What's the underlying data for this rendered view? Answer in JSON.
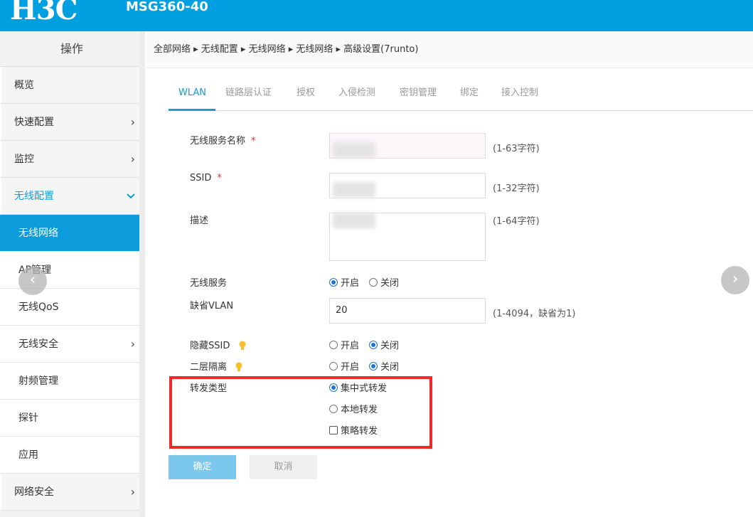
{
  "header": {
    "logo": "H3C",
    "model": "MSG360-40"
  },
  "sidebar": {
    "title": "操作",
    "items": [
      {
        "label": "概览",
        "chevron": ""
      },
      {
        "label": "快速配置",
        "chevron": "›"
      },
      {
        "label": "监控",
        "chevron": "›"
      },
      {
        "label": "无线配置",
        "chevron": "⌄"
      }
    ],
    "sub_items": [
      {
        "label": "无线网络",
        "chevron": ""
      },
      {
        "label": "AP管理",
        "chevron": ""
      },
      {
        "label": "无线QoS",
        "chevron": ""
      },
      {
        "label": "无线安全",
        "chevron": "›"
      },
      {
        "label": "射频管理",
        "chevron": ""
      },
      {
        "label": "探针",
        "chevron": ""
      },
      {
        "label": "应用",
        "chevron": ""
      }
    ],
    "bottom_item": {
      "label": "网络安全",
      "chevron": "›"
    }
  },
  "breadcrumb": "全部网络 ▸ 无线配置 ▸ 无线网络 ▸ 无线网络 ▸ 高级设置(7runto)",
  "tabs": [
    "WLAN",
    "链路层认证",
    "授权",
    "入侵检测",
    "密钥管理",
    "绑定",
    "接入控制"
  ],
  "form": {
    "service_name": {
      "label": "无线服务名称",
      "required": "*",
      "hint": "(1-63字符)"
    },
    "ssid": {
      "label": "SSID",
      "required": "*",
      "hint": "(1-32字符)"
    },
    "description": {
      "label": "描述",
      "hint": "(1-64字符)"
    },
    "wireless_service": {
      "label": "无线服务",
      "on": "开启",
      "off": "关闭",
      "selected": "开启"
    },
    "default_vlan": {
      "label": "缺省VLAN",
      "value": "20",
      "hint": "(1-4094，缺省为1)"
    },
    "hide_ssid": {
      "label": "隐藏SSID",
      "on": "开启",
      "off": "关闭",
      "selected": "关闭"
    },
    "l2_isolation": {
      "label": "二层隔离",
      "on": "开启",
      "off": "关闭",
      "selected": "关闭"
    },
    "forwarding_type": {
      "label": "转发类型",
      "centralized": "集中式转发",
      "local": "本地转发",
      "policy": "策略转发",
      "selected": "集中式转发"
    }
  },
  "buttons": {
    "ok": "确定",
    "cancel": "取消"
  },
  "nav": {
    "prev": "‹",
    "next": "›"
  },
  "colors": {
    "header": "#00a0e0",
    "accent": "#1a9ad6",
    "highlight": "#ee2b2b"
  }
}
